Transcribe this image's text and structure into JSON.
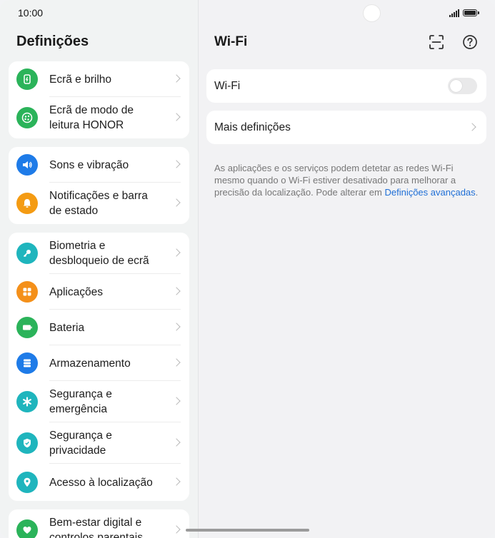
{
  "status": {
    "time": "10:00"
  },
  "left": {
    "title": "Definições",
    "groups": [
      [
        {
          "label": "Ecrã e brilho",
          "icon": "display-brightness-icon",
          "color": "#2bb35a"
        },
        {
          "label": "Ecrã de modo de leitura HONOR",
          "icon": "eye-comfort-icon",
          "color": "#2bb35a"
        }
      ],
      [
        {
          "label": "Sons e vibração",
          "icon": "speaker-icon",
          "color": "#1e7be8"
        },
        {
          "label": "Notificações e barra de estado",
          "icon": "bell-icon",
          "color": "#f49b13"
        }
      ],
      [
        {
          "label": "Biometria e desbloqueio de ecrã",
          "icon": "key-icon",
          "color": "#1fb5bd"
        },
        {
          "label": "Aplicações",
          "icon": "apps-grid-icon",
          "color": "#f4901a"
        },
        {
          "label": "Bateria",
          "icon": "battery-icon",
          "color": "#2bb35a"
        },
        {
          "label": "Armazenamento",
          "icon": "storage-icon",
          "color": "#1e7be8"
        },
        {
          "label": "Segurança e emergência",
          "icon": "asterisk-icon",
          "color": "#1fb5bd"
        },
        {
          "label": "Segurança e privacidade",
          "icon": "shield-icon",
          "color": "#1fb5bd"
        },
        {
          "label": "Acesso à localização",
          "icon": "location-pin-icon",
          "color": "#1fb5bd"
        }
      ],
      [
        {
          "label": "Bem-estar digital e controlos parentais",
          "icon": "heart-hand-icon",
          "color": "#2bb35a"
        }
      ]
    ]
  },
  "right": {
    "title": "Wi-Fi",
    "wifi_label": "Wi-Fi",
    "wifi_enabled": false,
    "more_label": "Mais definições",
    "note_text": "As aplicações e os serviços podem detetar as redes Wi-Fi mesmo quando o Wi-Fi estiver desativado para melhorar a precisão da localização. Pode alterar em ",
    "note_link": "Definições avançadas",
    "note_end": "."
  },
  "colors": {
    "link": "#1f6fd6",
    "accent_green": "#2bb35a"
  }
}
